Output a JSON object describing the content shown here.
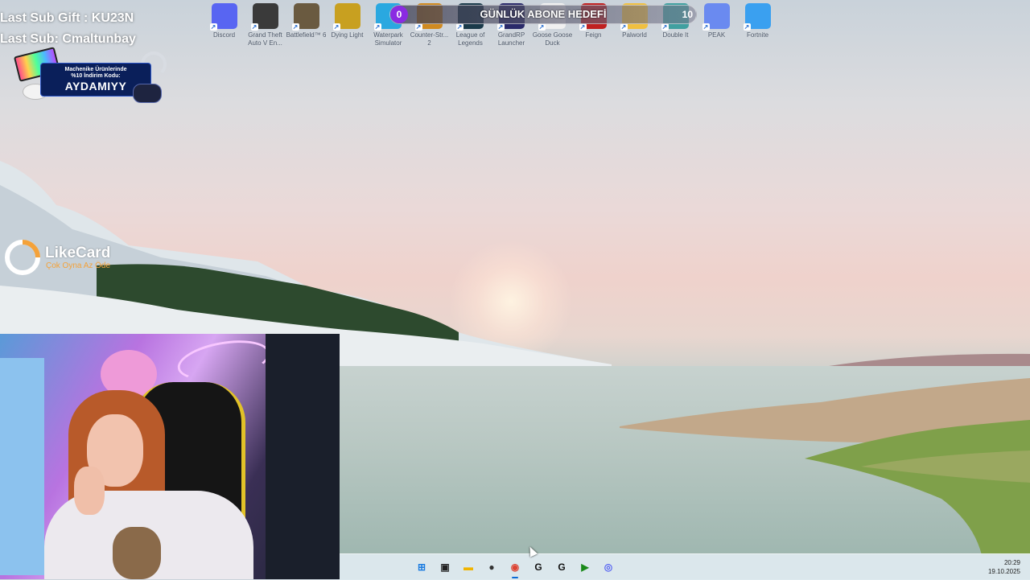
{
  "overlay": {
    "last_sub_gift": "Last Sub Gift : KU23N",
    "last_sub": "Last Sub: Cmaltunbay",
    "promo": {
      "line1": "Machenike Ürünlerinde",
      "line2": "%10 İndirim Kodu:",
      "code": "AYDAMIYY"
    },
    "likecard": {
      "name": "LikeCard",
      "tagline": "Çok Oyna   Az Öde"
    },
    "sub_goal": {
      "title": "GÜNLÜK ABONE HEDEFİ",
      "current": "0",
      "target": "10",
      "progress": 0
    }
  },
  "desktop_icons": [
    {
      "label": "Discord",
      "icon": "discord-icon",
      "color": "#5865f2"
    },
    {
      "label": "Grand Theft\nAuto V En...",
      "icon": "gta-icon",
      "color": "#3a3a3a"
    },
    {
      "label": "Battlefield™ 6",
      "icon": "battlefield-icon",
      "color": "#6a5a40"
    },
    {
      "label": "Dying Light",
      "icon": "dying-light-icon",
      "color": "#c8a020"
    },
    {
      "label": "Waterpark\nSimulator",
      "icon": "waterpark-icon",
      "color": "#2aa8e0"
    },
    {
      "label": "Counter-Str...\n2",
      "icon": "counter-strike-icon",
      "color": "#d08a20"
    },
    {
      "label": "League of\nLegends",
      "icon": "league-icon",
      "color": "#1a3a4a"
    },
    {
      "label": "GrandRP\nLauncher",
      "icon": "grandrp-icon",
      "color": "#2a2a6a"
    },
    {
      "label": "Goose Goose\nDuck",
      "icon": "goose-icon",
      "color": "#f0f0f0"
    },
    {
      "label": "Feign",
      "icon": "feign-icon",
      "color": "#c02020"
    },
    {
      "label": "Palworld",
      "icon": "palworld-icon",
      "color": "#f0c040"
    },
    {
      "label": "Double It",
      "icon": "double-it-icon",
      "color": "#40a0a0"
    },
    {
      "label": "PEAK",
      "icon": "peak-icon",
      "color": "#6a8af0"
    },
    {
      "label": "Fortnite",
      "icon": "fortnite-icon",
      "color": "#3aa0f0"
    }
  ],
  "taskbar": {
    "icons": [
      {
        "name": "start-icon",
        "glyph": "⊞",
        "color": "#1a7be0"
      },
      {
        "name": "task-view-icon",
        "glyph": "▣",
        "color": "#222222"
      },
      {
        "name": "file-explorer-icon",
        "glyph": "▬",
        "color": "#f0b400"
      },
      {
        "name": "obs-icon",
        "glyph": "●",
        "color": "#333333"
      },
      {
        "name": "chrome-icon",
        "glyph": "◉",
        "color": "#dd4433",
        "active": true
      },
      {
        "name": "g-hub-icon",
        "glyph": "G",
        "color": "#111111"
      },
      {
        "name": "g-hub-2-icon",
        "glyph": "G",
        "color": "#111111"
      },
      {
        "name": "nvidia-icon",
        "glyph": "▶",
        "color": "#1a8a1a"
      },
      {
        "name": "discord-taskbar-icon",
        "glyph": "◎",
        "color": "#5865f2"
      }
    ],
    "time": "20:29",
    "date": "19.10.2025"
  }
}
